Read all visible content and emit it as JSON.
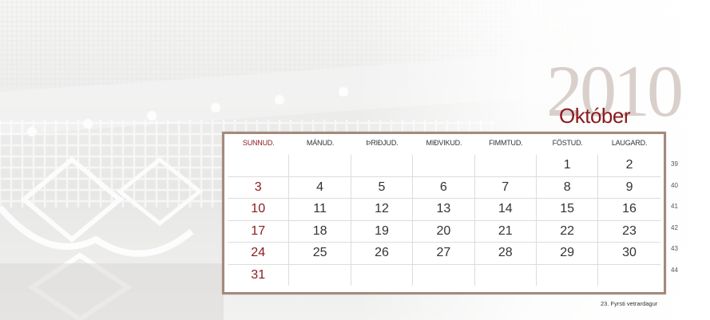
{
  "year": "2010",
  "month": "Október",
  "weekdays": [
    "SUNNUD.",
    "MÁNUD.",
    "ÞRIÐJUD.",
    "MIÐVIKUD.",
    "FIMMTUD.",
    "FÖSTUD.",
    "LAUGARD."
  ],
  "weeks": [
    [
      "",
      "",
      "",
      "",
      "",
      "1",
      "2"
    ],
    [
      "3",
      "4",
      "5",
      "6",
      "7",
      "8",
      "9"
    ],
    [
      "10",
      "11",
      "12",
      "13",
      "14",
      "15",
      "16"
    ],
    [
      "17",
      "18",
      "19",
      "20",
      "21",
      "22",
      "23"
    ],
    [
      "24",
      "25",
      "26",
      "27",
      "28",
      "29",
      "30"
    ],
    [
      "31",
      "",
      "",
      "",
      "",
      "",
      ""
    ]
  ],
  "week_numbers": [
    "39",
    "40",
    "41",
    "42",
    "43",
    "44"
  ],
  "note": "23. Fyrsti vetrardagur",
  "colors": {
    "sunday": "#8b1a1f",
    "frame": "#a48a7c",
    "year": "#d9cfcb"
  }
}
